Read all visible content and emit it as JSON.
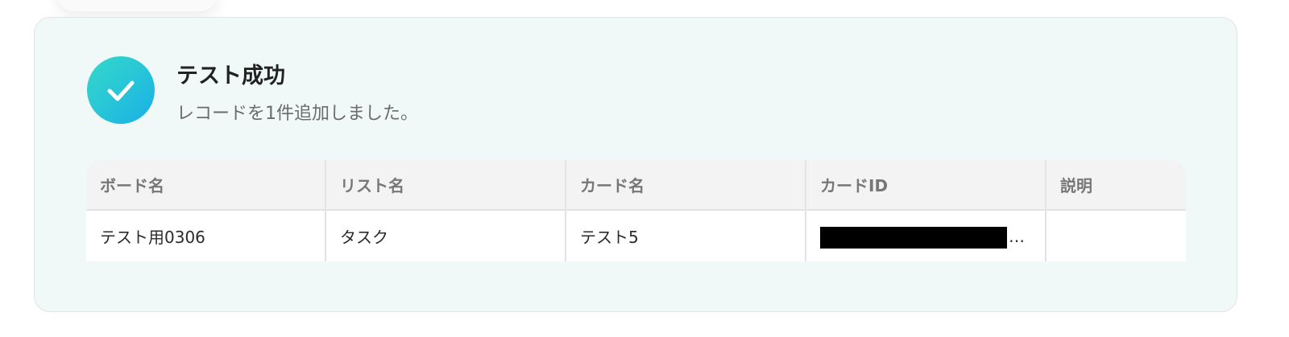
{
  "result": {
    "title": "テスト成功",
    "message": "レコードを1件追加しました。",
    "icon": "check-circle-icon"
  },
  "table": {
    "headers": [
      "ボード名",
      "リスト名",
      "カード名",
      "カードID",
      "説明"
    ],
    "row": {
      "board_name": "テスト用0306",
      "list_name": "タスク",
      "card_name": "テスト5",
      "card_id_suffix": "…",
      "description": ""
    }
  },
  "colors": {
    "card_background": "#f1f9f8",
    "icon_gradient_start": "#34d8c8",
    "icon_gradient_end": "#1aaee6",
    "table_header_background": "#f3f3f3"
  }
}
